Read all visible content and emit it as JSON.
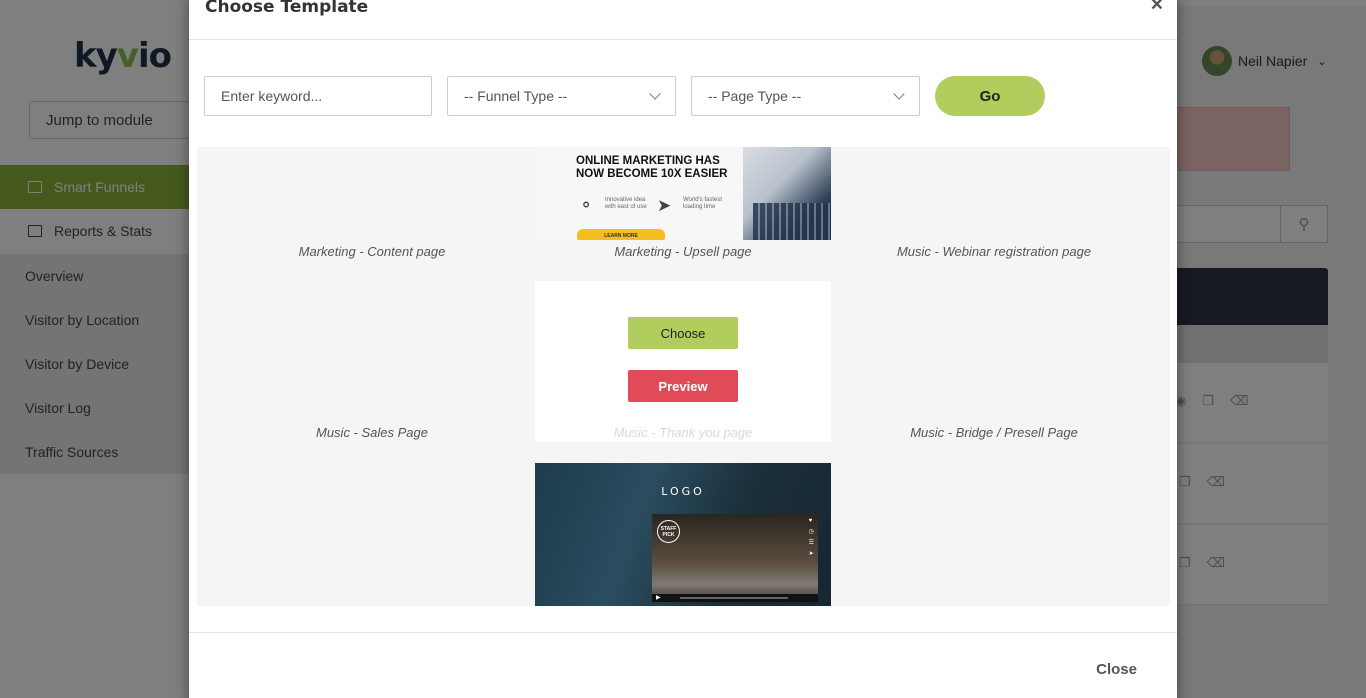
{
  "app": {
    "logo": {
      "pre": "ky",
      "accent": "v",
      "post": "io"
    },
    "jump_to_module": "Jump to module",
    "nav": [
      {
        "label": "Smart Funnels",
        "active": true
      },
      {
        "label": "Reports & Stats",
        "active": false
      }
    ],
    "sub_nav": [
      "Overview",
      "Visitor by Location",
      "Visitor by Device",
      "Visitor Log",
      "Traffic Sources"
    ],
    "user": {
      "name": "Neil Napier"
    }
  },
  "modal": {
    "title": "Choose Template",
    "keyword_placeholder": "Enter keyword...",
    "funnel_type": "-- Funnel Type --",
    "page_type": "-- Page Type --",
    "go_label": "Go",
    "templates": [
      {
        "caption": "Marketing - Content page"
      },
      {
        "caption": "Marketing - Upsell page"
      },
      {
        "caption": "Music - Webinar registration page"
      },
      {
        "caption": "Music - Sales Page"
      },
      {
        "caption": "Music - Thank you page"
      },
      {
        "caption": "Music - Bridge / Presell Page"
      }
    ],
    "hover_actions": {
      "choose": "Choose",
      "preview": "Preview"
    },
    "thumb1": {
      "headline": "ONLINE MARKETING HAS NOW BECOME 10X EASIER",
      "feature1": "Innovative idea with east of use",
      "feature2": "World's fastest loading time",
      "cta": "LEARN MORE"
    },
    "thumb3": {
      "logo": "LOGO",
      "badge": "STAFF PICK"
    },
    "close_label": "Close"
  },
  "colors": {
    "accent_green": "#8db33a",
    "button_green": "#b0cd5e",
    "preview_red": "#e14a57"
  }
}
